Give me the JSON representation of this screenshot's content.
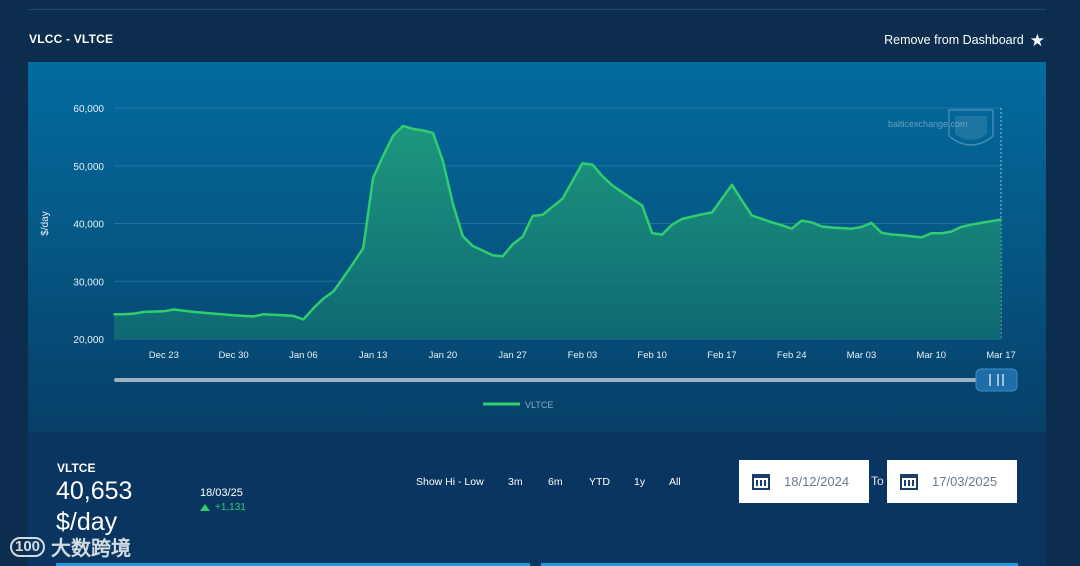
{
  "panel": {
    "title": "VLCC - VLTCE",
    "remove_label": "Remove from Dashboard"
  },
  "colors": {
    "series": "#2fce6e",
    "area": "#1c8a7a",
    "background": "#0c2d4e",
    "accent": "#1a9be0"
  },
  "icons": {
    "favorite": "star-icon",
    "calendar": "calendar-icon"
  },
  "chart_data": {
    "type": "area",
    "title": "",
    "xlabel": "",
    "ylabel": "$/day",
    "ylim": [
      20000,
      60000
    ],
    "yticks": [
      20000,
      30000,
      40000,
      50000,
      60000
    ],
    "y_tick_labels": [
      "20,000",
      "30,000",
      "40,000",
      "50,000",
      "60,000"
    ],
    "x_tick_labels": [
      "Dec 23",
      "Dec 30",
      "Jan 06",
      "Jan 13",
      "Jan 20",
      "Jan 27",
      "Feb 03",
      "Feb 10",
      "Feb 17",
      "Feb 24",
      "Mar 03",
      "Mar 10",
      "Mar 17"
    ],
    "x_tick_days": [
      5,
      12,
      19,
      26,
      33,
      40,
      47,
      54,
      61,
      68,
      75,
      82,
      89
    ],
    "x_range_days": [
      0,
      89
    ],
    "x_origin": "2024-12-18",
    "grid": true,
    "legend": "bottom",
    "watermark": "balticexchange.com",
    "series": [
      {
        "name": "VLTCE",
        "x": [
          0,
          1,
          2,
          3,
          5,
          6,
          7,
          8,
          10,
          12,
          14,
          15,
          16,
          18,
          19,
          20,
          21,
          22,
          23,
          24,
          25,
          26,
          27,
          28,
          29,
          30,
          31,
          32,
          33,
          34,
          35,
          36,
          37,
          38,
          39,
          40,
          41,
          42,
          43,
          44,
          45,
          47,
          48,
          49,
          50,
          51,
          53,
          54,
          55,
          56,
          57,
          58,
          59,
          60,
          61,
          62,
          63,
          64,
          65,
          66,
          67,
          68,
          69,
          70,
          71,
          72,
          73,
          74,
          75,
          76,
          77,
          78,
          79,
          80,
          81,
          82,
          83,
          84,
          85,
          86,
          87,
          88,
          89
        ],
        "y": [
          24300,
          24300,
          24400,
          24700,
          24800,
          25100,
          24900,
          24700,
          24400,
          24100,
          23900,
          24300,
          24200,
          24000,
          23400,
          25300,
          27000,
          28200,
          30600,
          33100,
          35700,
          47900,
          51700,
          55200,
          56900,
          56400,
          56100,
          55700,
          50800,
          43400,
          37800,
          36100,
          35300,
          34500,
          34300,
          36400,
          37700,
          41300,
          41500,
          42900,
          44300,
          50400,
          50200,
          48200,
          46600,
          45400,
          43100,
          38300,
          38100,
          39800,
          40800,
          41200,
          41600,
          41900,
          44300,
          46700,
          44000,
          41400,
          40800,
          40200,
          39700,
          39100,
          40500,
          40200,
          39500,
          39300,
          39200,
          39100,
          39400,
          40100,
          38400,
          38100,
          38000,
          37800,
          37600,
          38300,
          38300,
          38600,
          39400,
          39800,
          40100,
          40400,
          40653
        ]
      }
    ]
  },
  "summary": {
    "series_name": "VLTCE",
    "value": "40,653",
    "unit": "$/day",
    "date": "18/03/25",
    "change": "+1,131"
  },
  "range_buttons": [
    "Show Hi - Low",
    "3m",
    "6m",
    "YTD",
    "1y",
    "All"
  ],
  "date_range": {
    "from": "18/12/2024",
    "to_label": "To",
    "to": "17/03/2025"
  },
  "watermark": {
    "logo": "100",
    "text": "大数跨境"
  }
}
